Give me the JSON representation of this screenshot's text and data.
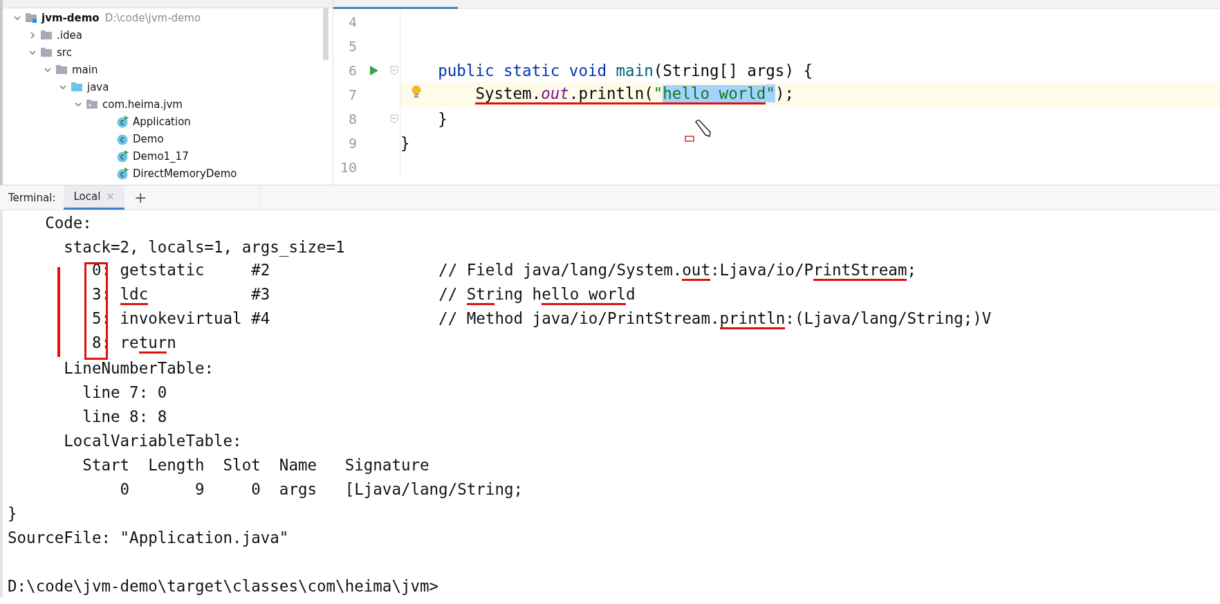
{
  "project_tree": {
    "items": [
      {
        "name": "jvm-demo",
        "path": "D:\\code\\jvm-demo",
        "kind": "module",
        "expanded": true,
        "children": [
          {
            "name": ".idea",
            "kind": "folder",
            "expanded": false
          },
          {
            "name": "src",
            "kind": "folder",
            "expanded": true,
            "children": [
              {
                "name": "main",
                "kind": "folder",
                "expanded": true,
                "children": [
                  {
                    "name": "java",
                    "kind": "source",
                    "expanded": true,
                    "children": [
                      {
                        "name": "com.heima.jvm",
                        "kind": "package",
                        "expanded": true,
                        "children": [
                          {
                            "name": "Application",
                            "kind": "class",
                            "runnable": true
                          },
                          {
                            "name": "Demo",
                            "kind": "class",
                            "runnable": false
                          },
                          {
                            "name": "Demo1_17",
                            "kind": "class",
                            "runnable": true
                          },
                          {
                            "name": "DirectMemoryDemo",
                            "kind": "class",
                            "runnable": true
                          }
                        ]
                      }
                    ]
                  }
                ]
              }
            ]
          }
        ]
      }
    ]
  },
  "editor": {
    "pointer": {
      "kind": "pencil"
    },
    "lines": [
      {
        "number": "4",
        "current": false,
        "run": false,
        "fold": false,
        "bulb": false
      },
      {
        "number": "5",
        "current": false,
        "run": false,
        "fold": false,
        "bulb": false
      },
      {
        "number": "6",
        "current": false,
        "run": true,
        "fold": true,
        "bulb": false,
        "segments": [
          {
            "text": "    public static void",
            "kind": "keyword"
          },
          {
            "text": " main",
            "kind": "method"
          },
          {
            "text": "(String[] args) {"
          }
        ]
      },
      {
        "number": "7",
        "current": true,
        "run": false,
        "fold": false,
        "bulb": true,
        "segments": [
          {
            "text": "        System.",
            "underlined": true
          },
          {
            "text": "out",
            "kind": "field",
            "underlined": true
          },
          {
            "text": ".println(",
            "underlined": true
          },
          {
            "text": "\"",
            "kind": "string",
            "underlined": true
          },
          {
            "text": "hello world",
            "kind": "string",
            "underlined": true,
            "selected": true
          },
          {
            "text": "\"",
            "kind": "string",
            "selected": true
          },
          {
            "text": ");"
          }
        ]
      },
      {
        "number": "8",
        "current": false,
        "run": false,
        "fold": true,
        "bulb": false,
        "segments": [
          {
            "text": "    }"
          }
        ]
      },
      {
        "number": "9",
        "current": false,
        "run": false,
        "fold": false,
        "bulb": false,
        "segments": [
          {
            "text": "}"
          }
        ]
      },
      {
        "number": "10",
        "current": false,
        "run": false,
        "fold": false,
        "bulb": false
      }
    ]
  },
  "terminal": {
    "label": "Terminal:",
    "tabs": [
      {
        "title": "Local",
        "selected": true,
        "close": "×"
      }
    ],
    "add": "+",
    "annotations": {
      "offset_box": true,
      "margin_line": true
    },
    "lines": [
      {
        "kind": "output",
        "text": "    Code:"
      },
      {
        "kind": "output",
        "text": "      stack=2, locals=1, args_size=1"
      },
      {
        "kind": "output",
        "segments": [
          {
            "text": "         0: getstatic     #2                  // Field java/lang/System."
          },
          {
            "text": "out",
            "underlined": true
          },
          {
            "text": ":Ljava/io/P"
          },
          {
            "text": "rintStream",
            "underlined": true
          },
          {
            "text": ";"
          }
        ]
      },
      {
        "kind": "output",
        "segments": [
          {
            "text": "         3: "
          },
          {
            "text": "ldc",
            "underlined": true
          },
          {
            "text": "           #3                  // "
          },
          {
            "text": "Str",
            "underlined": true
          },
          {
            "text": "ing h"
          },
          {
            "text": "ello worl",
            "underlined": true
          },
          {
            "text": "d"
          }
        ]
      },
      {
        "kind": "output",
        "segments": [
          {
            "text": "         5: invokevirtual #4                  // Method java/io/PrintStream."
          },
          {
            "text": "println",
            "underlined": true
          },
          {
            "text": ":(Ljava/lang/String;)V"
          }
        ]
      },
      {
        "kind": "output",
        "segments": [
          {
            "text": "         8: re"
          },
          {
            "text": "tur",
            "underlined": true
          },
          {
            "text": "n"
          }
        ]
      },
      {
        "kind": "output",
        "text": "      LineNumberTable:"
      },
      {
        "kind": "output",
        "text": "        line 7: 0"
      },
      {
        "kind": "output",
        "text": "        line 8: 8"
      },
      {
        "kind": "output",
        "text": "      LocalVariableTable:"
      },
      {
        "kind": "output",
        "text": "        Start  Length  Slot  Name   Signature"
      },
      {
        "kind": "output",
        "text": "            0       9     0  args   [Ljava/lang/String;"
      },
      {
        "kind": "output",
        "text": "}"
      },
      {
        "kind": "output",
        "text": "SourceFile: \"Application.java\""
      },
      {
        "kind": "prompt",
        "text": "D:\\code\\jvm-demo\\target\\classes\\com\\heima\\jvm>"
      }
    ]
  }
}
